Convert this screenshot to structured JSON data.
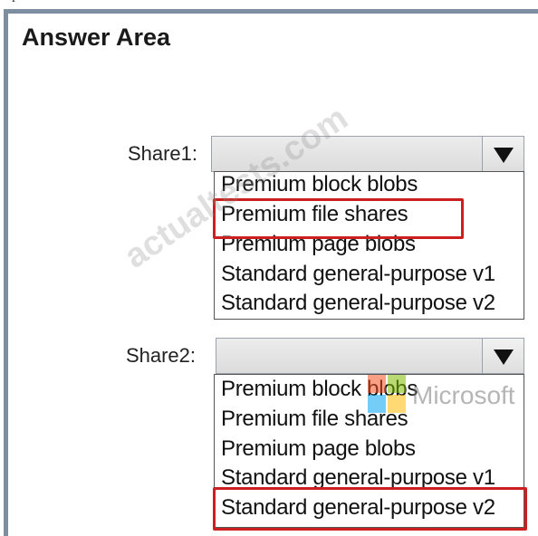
{
  "header_clip": "explanation",
  "answer_area": {
    "title": "Answer Area"
  },
  "share1": {
    "label": "Share1:",
    "options": [
      "Premium block blobs",
      "Premium file shares",
      "Premium page blobs",
      "Standard general-purpose v1",
      "Standard general-purpose v2"
    ],
    "selected": "Premium file shares"
  },
  "share2": {
    "label": "Share2:",
    "options": [
      "Premium block blobs",
      "Premium file shares",
      "Premium page blobs",
      "Standard general-purpose v1",
      "Standard general-purpose v2"
    ],
    "selected": "Standard general-purpose v2"
  },
  "overlays": {
    "watermark": "actualtests.com",
    "brand": "Microsoft"
  },
  "colors": {
    "highlight": "#cc2020",
    "panel_border": "#7d8ea1",
    "dropdown_bg": "#e4e4e4"
  }
}
